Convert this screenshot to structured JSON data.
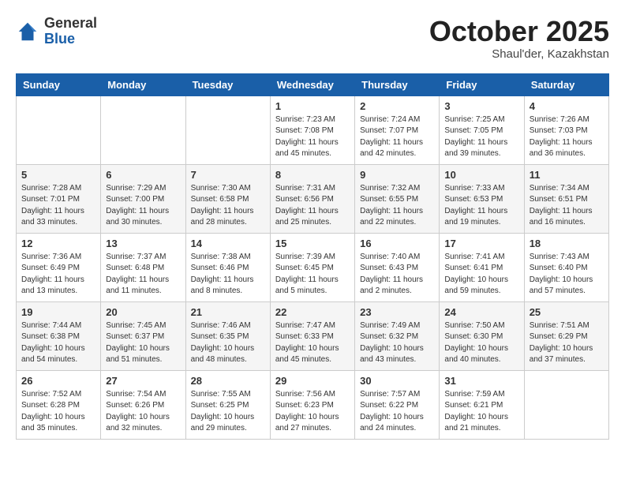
{
  "header": {
    "logo_general": "General",
    "logo_blue": "Blue",
    "month": "October 2025",
    "location": "Shaul'der, Kazakhstan"
  },
  "days_of_week": [
    "Sunday",
    "Monday",
    "Tuesday",
    "Wednesday",
    "Thursday",
    "Friday",
    "Saturday"
  ],
  "weeks": [
    [
      {
        "day": "",
        "info": ""
      },
      {
        "day": "",
        "info": ""
      },
      {
        "day": "",
        "info": ""
      },
      {
        "day": "1",
        "info": "Sunrise: 7:23 AM\nSunset: 7:08 PM\nDaylight: 11 hours and 45 minutes."
      },
      {
        "day": "2",
        "info": "Sunrise: 7:24 AM\nSunset: 7:07 PM\nDaylight: 11 hours and 42 minutes."
      },
      {
        "day": "3",
        "info": "Sunrise: 7:25 AM\nSunset: 7:05 PM\nDaylight: 11 hours and 39 minutes."
      },
      {
        "day": "4",
        "info": "Sunrise: 7:26 AM\nSunset: 7:03 PM\nDaylight: 11 hours and 36 minutes."
      }
    ],
    [
      {
        "day": "5",
        "info": "Sunrise: 7:28 AM\nSunset: 7:01 PM\nDaylight: 11 hours and 33 minutes."
      },
      {
        "day": "6",
        "info": "Sunrise: 7:29 AM\nSunset: 7:00 PM\nDaylight: 11 hours and 30 minutes."
      },
      {
        "day": "7",
        "info": "Sunrise: 7:30 AM\nSunset: 6:58 PM\nDaylight: 11 hours and 28 minutes."
      },
      {
        "day": "8",
        "info": "Sunrise: 7:31 AM\nSunset: 6:56 PM\nDaylight: 11 hours and 25 minutes."
      },
      {
        "day": "9",
        "info": "Sunrise: 7:32 AM\nSunset: 6:55 PM\nDaylight: 11 hours and 22 minutes."
      },
      {
        "day": "10",
        "info": "Sunrise: 7:33 AM\nSunset: 6:53 PM\nDaylight: 11 hours and 19 minutes."
      },
      {
        "day": "11",
        "info": "Sunrise: 7:34 AM\nSunset: 6:51 PM\nDaylight: 11 hours and 16 minutes."
      }
    ],
    [
      {
        "day": "12",
        "info": "Sunrise: 7:36 AM\nSunset: 6:49 PM\nDaylight: 11 hours and 13 minutes."
      },
      {
        "day": "13",
        "info": "Sunrise: 7:37 AM\nSunset: 6:48 PM\nDaylight: 11 hours and 11 minutes."
      },
      {
        "day": "14",
        "info": "Sunrise: 7:38 AM\nSunset: 6:46 PM\nDaylight: 11 hours and 8 minutes."
      },
      {
        "day": "15",
        "info": "Sunrise: 7:39 AM\nSunset: 6:45 PM\nDaylight: 11 hours and 5 minutes."
      },
      {
        "day": "16",
        "info": "Sunrise: 7:40 AM\nSunset: 6:43 PM\nDaylight: 11 hours and 2 minutes."
      },
      {
        "day": "17",
        "info": "Sunrise: 7:41 AM\nSunset: 6:41 PM\nDaylight: 10 hours and 59 minutes."
      },
      {
        "day": "18",
        "info": "Sunrise: 7:43 AM\nSunset: 6:40 PM\nDaylight: 10 hours and 57 minutes."
      }
    ],
    [
      {
        "day": "19",
        "info": "Sunrise: 7:44 AM\nSunset: 6:38 PM\nDaylight: 10 hours and 54 minutes."
      },
      {
        "day": "20",
        "info": "Sunrise: 7:45 AM\nSunset: 6:37 PM\nDaylight: 10 hours and 51 minutes."
      },
      {
        "day": "21",
        "info": "Sunrise: 7:46 AM\nSunset: 6:35 PM\nDaylight: 10 hours and 48 minutes."
      },
      {
        "day": "22",
        "info": "Sunrise: 7:47 AM\nSunset: 6:33 PM\nDaylight: 10 hours and 45 minutes."
      },
      {
        "day": "23",
        "info": "Sunrise: 7:49 AM\nSunset: 6:32 PM\nDaylight: 10 hours and 43 minutes."
      },
      {
        "day": "24",
        "info": "Sunrise: 7:50 AM\nSunset: 6:30 PM\nDaylight: 10 hours and 40 minutes."
      },
      {
        "day": "25",
        "info": "Sunrise: 7:51 AM\nSunset: 6:29 PM\nDaylight: 10 hours and 37 minutes."
      }
    ],
    [
      {
        "day": "26",
        "info": "Sunrise: 7:52 AM\nSunset: 6:28 PM\nDaylight: 10 hours and 35 minutes."
      },
      {
        "day": "27",
        "info": "Sunrise: 7:54 AM\nSunset: 6:26 PM\nDaylight: 10 hours and 32 minutes."
      },
      {
        "day": "28",
        "info": "Sunrise: 7:55 AM\nSunset: 6:25 PM\nDaylight: 10 hours and 29 minutes."
      },
      {
        "day": "29",
        "info": "Sunrise: 7:56 AM\nSunset: 6:23 PM\nDaylight: 10 hours and 27 minutes."
      },
      {
        "day": "30",
        "info": "Sunrise: 7:57 AM\nSunset: 6:22 PM\nDaylight: 10 hours and 24 minutes."
      },
      {
        "day": "31",
        "info": "Sunrise: 7:59 AM\nSunset: 6:21 PM\nDaylight: 10 hours and 21 minutes."
      },
      {
        "day": "",
        "info": ""
      }
    ]
  ]
}
